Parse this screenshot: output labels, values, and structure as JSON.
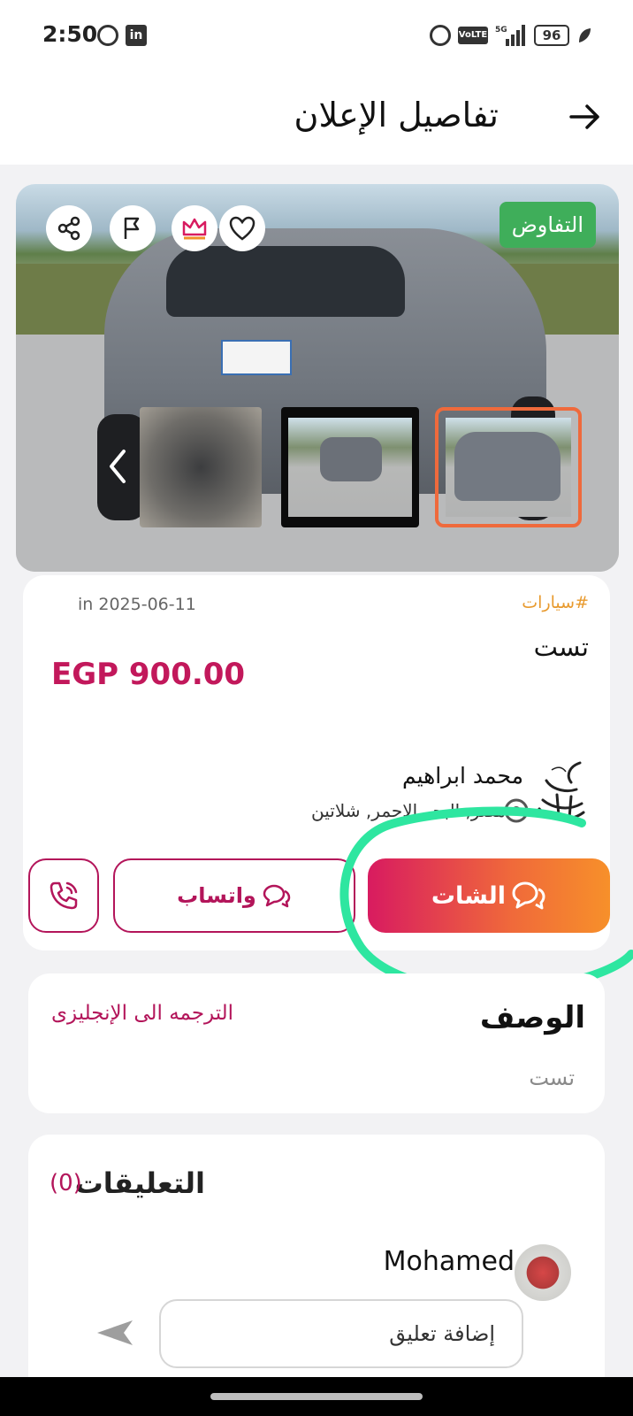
{
  "status_bar": {
    "time": "2:50",
    "network_label": "VoLTE",
    "battery_level": "96",
    "icons": [
      "whatsapp-icon",
      "linkedin-icon",
      "alarm-icon",
      "volte-icon",
      "signal-icon",
      "battery-icon",
      "leaf-icon"
    ]
  },
  "header": {
    "title": "تفاصيل الإعلان",
    "back_icon": "arrow-right-icon"
  },
  "gallery": {
    "badge": "التفاوض",
    "badge_color": "#3fae5a",
    "actions": [
      "share-icon",
      "flag-icon",
      "crown-icon",
      "heart-icon"
    ],
    "thumbnails": [
      "spare-tire",
      "car-front",
      "car-rear"
    ],
    "selected_thumbnail": 3
  },
  "listing": {
    "category": "#سيارات",
    "date": "in 2025-06-11",
    "title": "تست",
    "price": "EGP 900.00",
    "price_color": "#c2185b"
  },
  "seller": {
    "name": "محمد ابراهيم",
    "location": "مصر, البحر الاحمر, شلاتين"
  },
  "actions": {
    "chat_label": "الشات",
    "whatsapp_label": "واتساب",
    "call_icon": "phone-icon",
    "accent_color": "#b3155a"
  },
  "description": {
    "heading": "الوصف",
    "translate_label": "الترجمه الى الإنجليزى",
    "text": "تست"
  },
  "comments": {
    "heading": "التعليقات",
    "count": "(0)",
    "author": "Mohamed",
    "input_placeholder": "إضافة تعليق"
  }
}
